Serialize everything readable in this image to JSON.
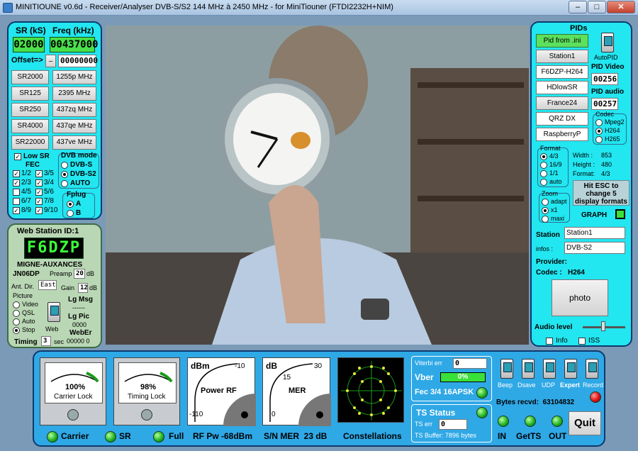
{
  "window": {
    "title": "MINITIOUNE v0.6d - Receiver/Analyser DVB-S/S2 144 MHz à 2450 MHz - for MiniTiouner (FTDI2232H+NIM)",
    "minimize": "–",
    "maximize": "□",
    "close": "✕"
  },
  "tuning": {
    "sr_label": "SR (kS)",
    "freq_label": "Freq (kHz)",
    "sr_value": "02000",
    "freq_value": "00437000",
    "offset_label": "Offset=>",
    "offset_sign": "–",
    "offset_value": "00000000",
    "presets": [
      {
        "sr": "SR2000",
        "freq": "1255p MHz"
      },
      {
        "sr": "SR125",
        "freq": "2395 MHz"
      },
      {
        "sr": "SR250",
        "freq": "437zq MHz"
      },
      {
        "sr": "SR4000",
        "freq": "437qe MHz"
      },
      {
        "sr": "SR22000",
        "freq": "437ve MHz"
      }
    ],
    "low_sr": "Low SR",
    "fec": "FEC",
    "fec_items": [
      "1/2",
      "3/5",
      "2/3",
      "3/4",
      "4/5",
      "5/6",
      "6/7",
      "7/8",
      "8/9",
      "9/10"
    ],
    "dvb_mode": "DVB mode",
    "dvb_options": [
      "DVB-S",
      "DVB-S2",
      "AUTO"
    ],
    "fplug": "Fplug",
    "fplug_options": [
      "A",
      "B"
    ]
  },
  "web": {
    "title": "Web Station ID:1",
    "callsign": "F6DZP",
    "location": "MIGNE-AUXANCES",
    "locator": "JN06DP",
    "preamp_label": "Preamp",
    "preamp_value": "20",
    "preamp_unit": "dB",
    "antdir_label": "Ant. Dir.",
    "antdir_value": "East",
    "gain_label": "Gain",
    "gain_value": "12",
    "gain_unit": "dB",
    "picture_label": "Picture",
    "picture_options": [
      "Video",
      "QSL",
      "Auto",
      "Stop"
    ],
    "web_label": "Web",
    "lg_msg": "Lg Msg",
    "lg_msg_value": "------",
    "lg_pic": "Lg Pic",
    "lg_pic_value": "0000",
    "weber": "WebEr",
    "weber_value": "00000 0",
    "timing_label": "Timing",
    "timing_value": "3",
    "timing_unit": "sec"
  },
  "pids": {
    "title": "PIDs",
    "buttons": [
      "Pid from .ini",
      "Station1",
      "F6DZP-H264",
      "HDlowSR",
      "France24",
      "QRZ DX",
      "RaspberryP"
    ],
    "autopid": "AutoPID",
    "pid_video_label": "PID Video",
    "pid_video": "00256",
    "pid_audio_label": "PID audio",
    "pid_audio": "00257",
    "codec_label": "Codec",
    "codec_options": [
      "Mpeg2",
      "H264",
      "H265"
    ],
    "format_label": "Format",
    "format_options": [
      "4/3",
      "16/9",
      "1/1",
      "auto"
    ],
    "width_label": "Width :",
    "width_value": "853",
    "height_label": "Height :",
    "height_value": "480",
    "fmt_label": "Format:",
    "fmt_value": "4/3",
    "esc_msg": "Hit ESC to change 5 display formats",
    "graph": "GRAPH",
    "zoom_label": "Zoom",
    "zoom_options": [
      "adapt",
      "x1",
      "maxi"
    ],
    "station_label": "Station",
    "station_value": "Station1",
    "infos_label": "infos :",
    "infos_value": "DVB-S2",
    "provider_label": "Provider:",
    "codec_line": "Codec :   H264",
    "photo": "photo",
    "audio_level": "Audio level",
    "info": "Info",
    "iss": "ISS"
  },
  "bottom": {
    "carrier_pct": "100%",
    "carrier_lock": "Carrier Lock",
    "timing_pct": "98%",
    "timing_lock": "Timing Lock",
    "dbm": "dBm",
    "power_rf": "Power RF",
    "rf_scale_top": "-10",
    "rf_scale_bottom": "-110",
    "db": "dB",
    "mer": "MER",
    "mer_scale_30": "30",
    "mer_scale_15": "15",
    "mer_scale_0": "0",
    "carrier": "Carrier",
    "sr": "SR",
    "full": "Full",
    "rfpw": "RF Pw -68dBm",
    "snmer": "S/N MER  23 dB",
    "constellations": "Constellations",
    "viterbi_label": "Viterbi err",
    "viterbi_value": "0",
    "vber": "Vber",
    "vber_value": "0%",
    "fec_line": "Fec 3/4 16APSK",
    "ts_status": "TS Status",
    "ts_err_label": "TS err",
    "ts_err_value": "0",
    "ts_buffer": "TS Buffer: 7896 bytes",
    "switches": [
      "Beep",
      "Dsave",
      "UDP",
      "Expert",
      "Record"
    ],
    "bytes_recvd": "Bytes recvd:  63104832",
    "in": "IN",
    "getts": "GetTS",
    "out": "OUT",
    "quit": "Quit"
  }
}
